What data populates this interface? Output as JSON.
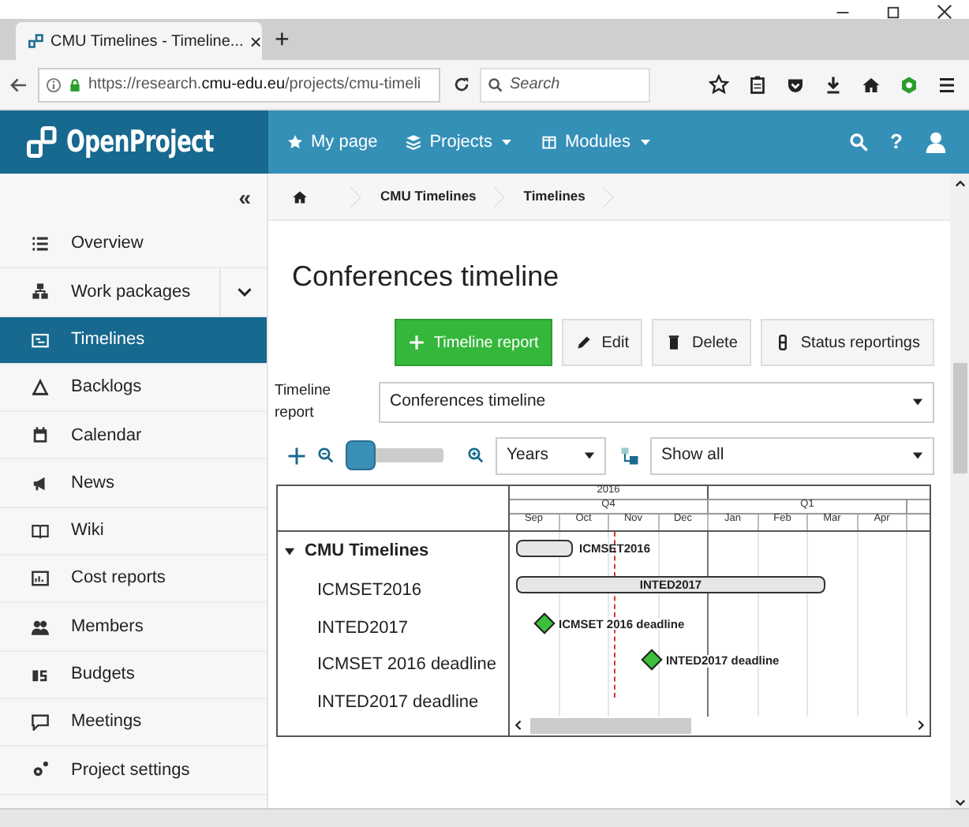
{
  "browser": {
    "tab_title": "CMU Timelines - Timeline...",
    "tab_close": "×",
    "new_tab": "+",
    "url_prefix": "https://research.",
    "url_domain": "cmu-edu.eu",
    "url_path": "/projects/cmu-timeli",
    "search_placeholder": "Search"
  },
  "header": {
    "logo": "OpenProject",
    "nav": [
      {
        "label": "My page",
        "has_caret": false
      },
      {
        "label": "Projects",
        "has_caret": true
      },
      {
        "label": "Modules",
        "has_caret": true
      }
    ],
    "help": "?"
  },
  "sidebar": {
    "collapse": "«",
    "items": [
      {
        "label": "Overview",
        "selected": false,
        "expandable": false
      },
      {
        "label": "Work packages",
        "selected": false,
        "expandable": true
      },
      {
        "label": "Timelines",
        "selected": true,
        "expandable": false
      },
      {
        "label": "Backlogs",
        "selected": false,
        "expandable": false
      },
      {
        "label": "Calendar",
        "selected": false,
        "expandable": false
      },
      {
        "label": "News",
        "selected": false,
        "expandable": false
      },
      {
        "label": "Wiki",
        "selected": false,
        "expandable": false
      },
      {
        "label": "Cost reports",
        "selected": false,
        "expandable": false
      },
      {
        "label": "Members",
        "selected": false,
        "expandable": false
      },
      {
        "label": "Budgets",
        "selected": false,
        "expandable": false
      },
      {
        "label": "Meetings",
        "selected": false,
        "expandable": false
      },
      {
        "label": "Project settings",
        "selected": false,
        "expandable": false
      }
    ]
  },
  "breadcrumb": [
    "CMU Timelines",
    "Timelines"
  ],
  "page_title": "Conferences timeline",
  "toolbar": [
    {
      "label": "Timeline report",
      "kind": "primary"
    },
    {
      "label": "Edit",
      "kind": "edit"
    },
    {
      "label": "Delete",
      "kind": "delete"
    },
    {
      "label": "Status reportings",
      "kind": "status"
    }
  ],
  "report_select": {
    "label": "Timeline report",
    "value": "Conferences timeline"
  },
  "zoom": {
    "level": 0.0,
    "scale": "Years",
    "filter": "Show all"
  },
  "timeline": {
    "years": [
      "2016"
    ],
    "quarters": [
      "Q4",
      "Q1"
    ],
    "months": [
      "Sep",
      "Oct",
      "Nov",
      "Dec",
      "Jan",
      "Feb",
      "Mar",
      "Apr"
    ],
    "group": {
      "label": "CMU Timelines",
      "expanded": true
    },
    "rows": [
      {
        "label": "ICMSET2016",
        "kind": "bar",
        "bar_label": "ICMSET2016"
      },
      {
        "label": "INTED2017",
        "kind": "bar",
        "bar_label": "INTED2017"
      },
      {
        "label": "ICMSET 2016 deadline",
        "kind": "milestone",
        "bar_label": "ICMSET 2016 deadline"
      },
      {
        "label": "INTED2017 deadline",
        "kind": "milestone",
        "bar_label": "INTED2017 deadline"
      }
    ]
  }
}
